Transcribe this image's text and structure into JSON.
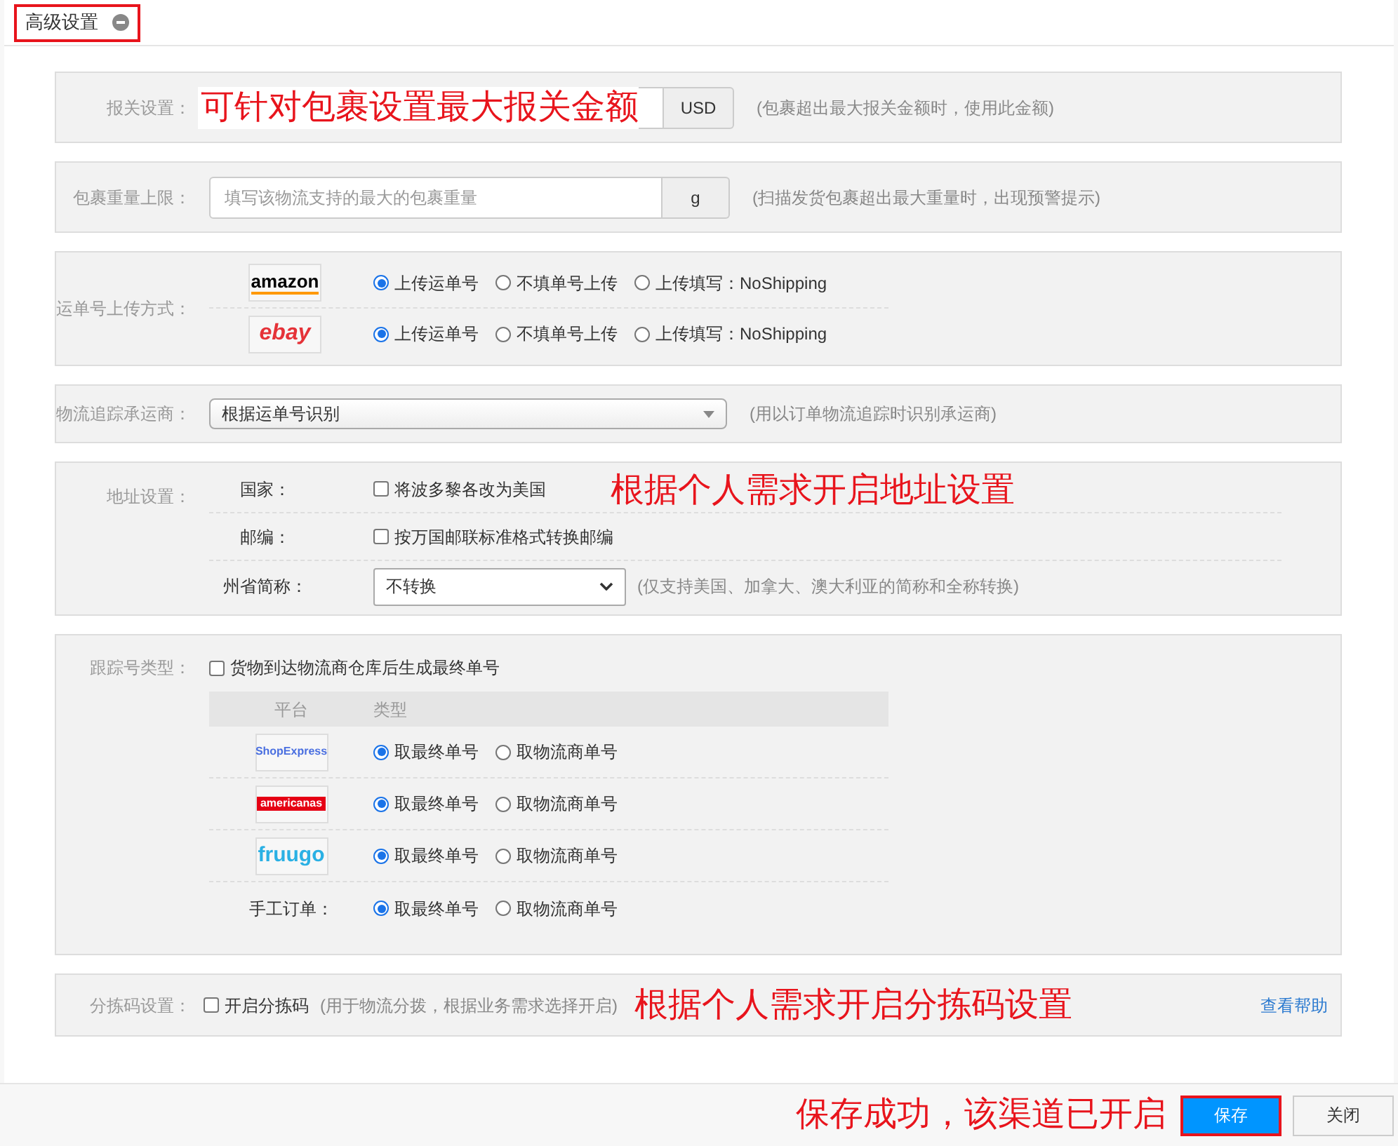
{
  "panel": {
    "title": "高级设置",
    "title_highlighted": true
  },
  "customs": {
    "label": "报关设置：",
    "unit": "USD",
    "hint": "(包裹超出最大报关金额时，使用此金额)",
    "annotation": "可针对包裹设置最大报关金额"
  },
  "weight_limit": {
    "label": "包裹重量上限：",
    "placeholder": "填写该物流支持的最大的包裹重量",
    "unit": "g",
    "hint": "(扫描发货包裹超出最大重量时，出现预警提示)"
  },
  "upload_method": {
    "label": "运单号上传方式：",
    "platforms": [
      {
        "kind": "amazon",
        "logo": "amazon",
        "options": [
          {
            "label": "上传运单号",
            "selected": true
          },
          {
            "label": "不填单号上传",
            "selected": false
          },
          {
            "label": "上传填写：NoShipping",
            "selected": false
          }
        ]
      },
      {
        "kind": "ebay",
        "logo": "ebay",
        "options": [
          {
            "label": "上传运单号",
            "selected": true
          },
          {
            "label": "不填单号上传",
            "selected": false
          },
          {
            "label": "上传填写：NoShipping",
            "selected": false
          }
        ]
      }
    ]
  },
  "carrier": {
    "label": "物流追踪承运商：",
    "value": "根据运单号识别",
    "hint": "(用以订单物流追踪时识别承运商)"
  },
  "address": {
    "label": "地址设置：",
    "annotation": "根据个人需求开启地址设置",
    "rows": [
      {
        "kind": "checkbox",
        "label": "国家：",
        "text": "将波多黎各改为美国",
        "checked": false
      },
      {
        "kind": "checkbox",
        "label": "邮编：",
        "text": "按万国邮联标准格式转换邮编",
        "checked": false
      },
      {
        "kind": "select",
        "label": "州省简称：",
        "value": "不转换",
        "hint": "(仅支持美国、加拿大、澳大利亚的简称和全称转换)"
      }
    ]
  },
  "tracking_type": {
    "label": "跟踪号类型：",
    "option": {
      "text": "货物到达物流商仓库后生成最终单号",
      "checked": false
    },
    "columns": [
      "平台",
      "类型"
    ],
    "rows": [
      {
        "kind": "shopexpress",
        "platform": "ShopExpress",
        "options": [
          {
            "label": "取最终单号",
            "selected": true
          },
          {
            "label": "取物流商单号",
            "selected": false
          }
        ]
      },
      {
        "kind": "americanas",
        "platform": "americanas",
        "options": [
          {
            "label": "取最终单号",
            "selected": true
          },
          {
            "label": "取物流商单号",
            "selected": false
          }
        ]
      },
      {
        "kind": "fruugo",
        "platform": "fruugo",
        "options": [
          {
            "label": "取最终单号",
            "selected": true
          },
          {
            "label": "取物流商单号",
            "selected": false
          }
        ]
      },
      {
        "kind": "text",
        "platform": "手工订单：",
        "options": [
          {
            "label": "取最终单号",
            "selected": true
          },
          {
            "label": "取物流商单号",
            "selected": false
          }
        ]
      }
    ]
  },
  "sorting_code": {
    "label": "分拣码设置：",
    "option": {
      "text": "开启分拣码",
      "checked": false
    },
    "hint": "(用于物流分拨，根据业务需求选择开启)",
    "annotation": "根据个人需求开启分拣码设置",
    "help_link": "查看帮助"
  },
  "footer": {
    "annotation": "保存成功，该渠道已开启",
    "buttons": [
      {
        "label": "保存",
        "kind": "primary",
        "highlighted": true
      },
      {
        "label": "关闭",
        "kind": "default",
        "highlighted": false
      }
    ]
  }
}
